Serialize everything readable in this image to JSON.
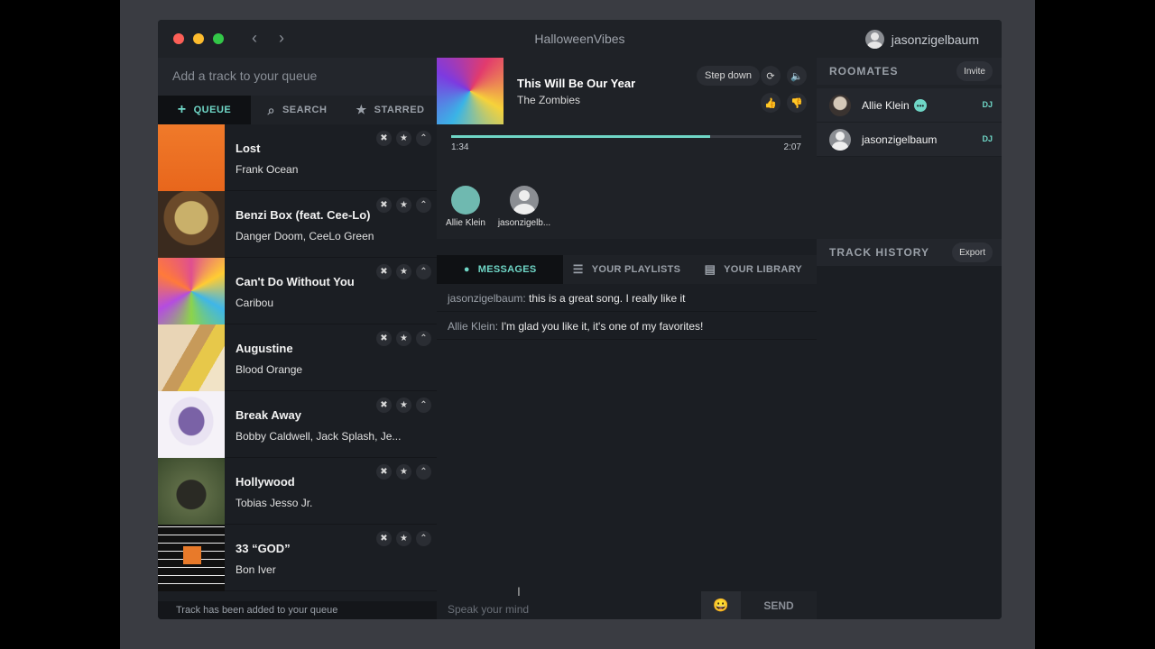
{
  "window": {
    "title": "HalloweenVibes",
    "user": "jasonzigelbaum"
  },
  "queue": {
    "add_placeholder": "Add a track to your queue",
    "tabs": [
      {
        "icon": "plus-icon",
        "glyph": "+",
        "label": "QUEUE",
        "active": true
      },
      {
        "icon": "search-icon",
        "glyph": "⌕",
        "label": "SEARCH",
        "active": false
      },
      {
        "icon": "star-icon",
        "glyph": "★",
        "label": "STARRED",
        "active": false
      }
    ],
    "items": [
      {
        "title": "Lost",
        "artist": "Frank Ocean",
        "art": "art-lost"
      },
      {
        "title": "Benzi Box (feat. Cee-Lo)",
        "artist": "Danger Doom, CeeLo Green",
        "art": "art-benzi"
      },
      {
        "title": "Can't Do Without You",
        "artist": "Caribou",
        "art": "art-caribou"
      },
      {
        "title": "Augustine",
        "artist": "Blood Orange",
        "art": "art-aug"
      },
      {
        "title": "Break Away",
        "artist": "Bobby Caldwell, Jack Splash, Je...",
        "art": "art-break"
      },
      {
        "title": "Hollywood",
        "artist": "Tobias Jesso Jr.",
        "art": "art-holly"
      },
      {
        "title": "33 “GOD”",
        "artist": "Bon Iver",
        "art": "art-god"
      }
    ],
    "toast": "Track has been added to your queue"
  },
  "now_playing": {
    "title": "This Will Be Our Year",
    "artist": "The Zombies",
    "step_down": "Step down",
    "elapsed": "1:34",
    "duration": "2:07",
    "progress": 0.74
  },
  "listeners": [
    {
      "name": "Allie Klein"
    },
    {
      "name": "jasonzigelb..."
    }
  ],
  "center_tabs": [
    {
      "icon": "chat-icon",
      "glyph": "💬",
      "label": "MESSAGES",
      "active": true
    },
    {
      "icon": "list-icon",
      "glyph": "☰",
      "label": "YOUR PLAYLISTS",
      "active": false
    },
    {
      "icon": "library-icon",
      "glyph": "▤",
      "label": "YOUR LIBRARY",
      "active": false
    }
  ],
  "messages": [
    {
      "who": "jasonzigelbaum:",
      "text": " this is a great song. I really like it"
    },
    {
      "who": "Allie Klein:",
      "text": " I'm glad you like it, it's one of my favorites!"
    }
  ],
  "compose": {
    "placeholder": "Speak your mind",
    "send": "SEND"
  },
  "roommates": {
    "heading": "ROOMATES",
    "invite": "Invite",
    "people": [
      {
        "name": "Allie Klein",
        "badge": "DJ"
      },
      {
        "name": "jasonzigelbaum",
        "badge": "DJ"
      }
    ]
  },
  "history": {
    "heading": "TRACK HISTORY",
    "export": "Export"
  },
  "colors": {
    "accent": "#6fd6c6",
    "bg": "#1b1e23",
    "panel": "#1f2227"
  }
}
